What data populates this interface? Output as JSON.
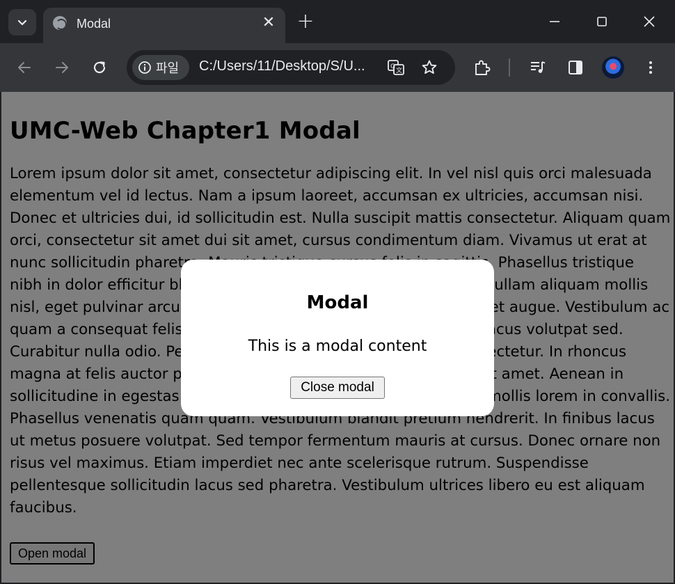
{
  "browser": {
    "tab": {
      "title": "Modal"
    },
    "address": {
      "site_label": "파일",
      "url": "C:/Users/11/Desktop/S/U..."
    }
  },
  "page": {
    "heading": "UMC-Web Chapter1 Modal",
    "paragraph": "Lorem ipsum dolor sit amet, consectetur adipiscing elit. In vel nisl quis orci malesuada elementum vel id lectus. Nam a ipsum laoreet, accumsan ex ultricies, accumsan nisi. Donec et ultricies dui, id sollicitudin est. Nulla suscipit mattis consectetur. Aliquam quam orci, consectetur sit amet dui sit amet, cursus condimentum diam. Vivamus ut erat at nunc sollicitudin pharetra. Mauris tristique cursus felis in sagittis. Phasellus tristique nibh in dolor efficitur blandit. Quisque pellentesque odio libero. Nullam aliquam mollis nisl, eget pulvinar arcu dui, sodales non est eu, faucibus imperdiet augue. Vestibulum ac quam a consequat felis. Mauris eleifend orci purus, a vulputate lacus volutpat sed. Curabitur nulla odio. Pellentesque vehicula in arcu sit amet consectetur. In rhoncus magna at felis auctor porta. Phasellus volutpat porttitor libero, sit amet. Aenean in sollicitudine in egestas nisl, lacinia eleifend augue. Morbi luctus mollis lorem in convallis. Phasellus venenatis quam quam. Vestibulum blandit pretium hendrerit. In finibus lacus ut metus posuere volutpat. Sed tempor fermentum mauris at cursus. Donec ornare non risus vel maximus. Etiam imperdiet nec ante scelerisque rutrum. Suspendisse pellentesque sollicitudin lacus sed pharetra. Vestibulum ultrices libero eu est aliquam faucibus.",
    "open_button": "Open modal"
  },
  "modal": {
    "title": "Modal",
    "content": "This is a modal content",
    "close_button": "Close modal"
  },
  "colors": {
    "overlay": "rgba(0,0,0,0.5)",
    "browser_dark": "#202124",
    "toolbar": "#35363a"
  }
}
